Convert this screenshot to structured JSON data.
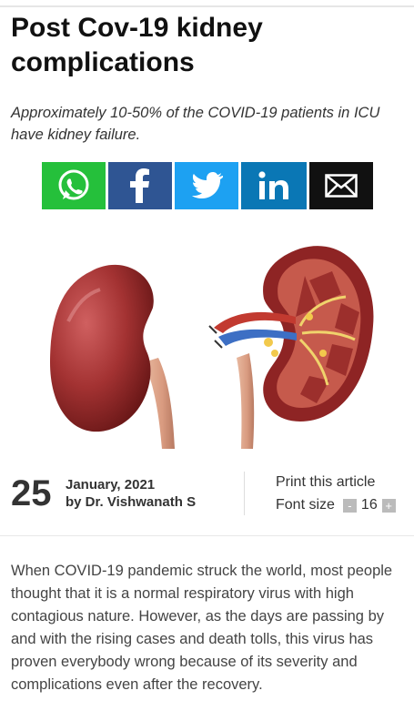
{
  "article": {
    "title": "Post Cov-19 kidney complications",
    "subtitle": "Approximately 10-50% of the COVID-19 patients in ICU have kidney failure.",
    "share": [
      "whatsapp-icon",
      "facebook-icon",
      "twitter-icon",
      "linkedin-icon",
      "email-icon"
    ],
    "share_colors": {
      "whatsapp": "#25c03b",
      "facebook": "#2f5593",
      "twitter": "#1da1f2",
      "linkedin": "#0a77b5",
      "email": "#111111"
    },
    "date_day": "25",
    "date_month_year": "January, 2021",
    "author": "by Dr. Vishwanath S",
    "print_label": "Print this article",
    "font_size_label": "Font size",
    "font_size_value": "16",
    "body": "When COVID-19 pandemic struck the world, most people thought that it is a normal respiratory virus with high contagious nature. However, as the days are passing by and with the rising cases and death tolls, this virus has proven everybody wrong because of its severity and complications even after the recovery."
  }
}
